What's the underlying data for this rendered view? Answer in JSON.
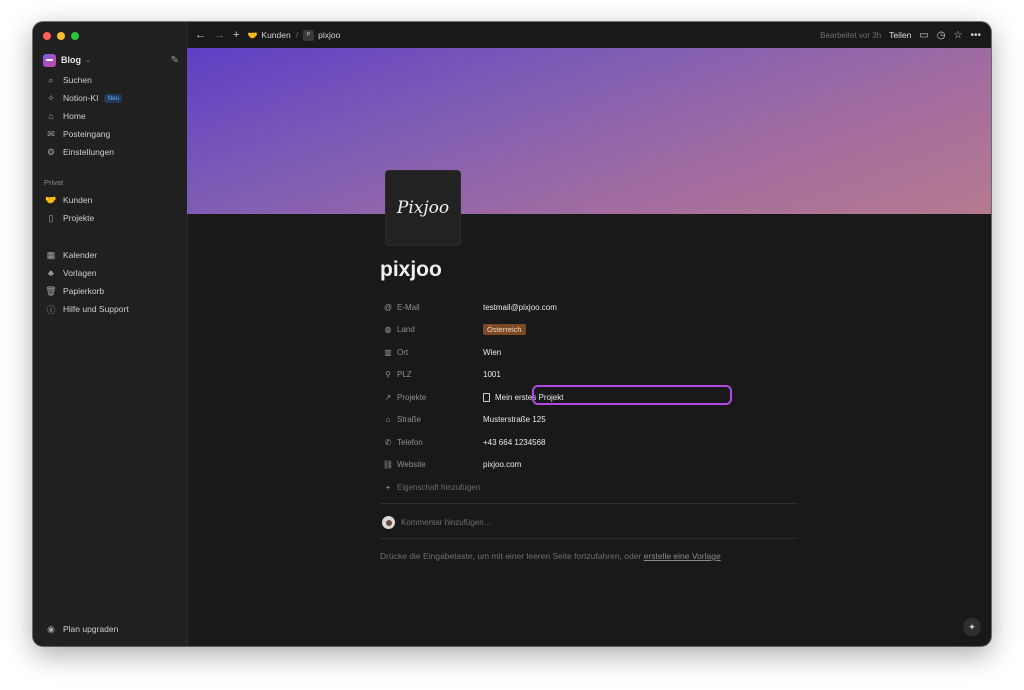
{
  "window": {
    "traffic_colors": [
      "#ff5f57",
      "#febc2e",
      "#28c840"
    ]
  },
  "sidebar": {
    "workspace_name": "Blog",
    "top_items": [
      {
        "label": "Suchen",
        "icon": "search-icon"
      },
      {
        "label": "Notion-KI",
        "icon": "sparkle-icon",
        "badge": "Neu"
      },
      {
        "label": "Home",
        "icon": "home-icon"
      },
      {
        "label": "Posteingang",
        "icon": "inbox-icon"
      },
      {
        "label": "Einstellungen",
        "icon": "gear-icon"
      }
    ],
    "section_label": "Privat",
    "private_items": [
      {
        "label": "Kunden",
        "icon": "handshake-icon"
      },
      {
        "label": "Projekte",
        "icon": "page-icon"
      }
    ],
    "tool_items": [
      {
        "label": "Kalender",
        "icon": "calendar-icon"
      },
      {
        "label": "Vorlagen",
        "icon": "templates-icon"
      },
      {
        "label": "Papierkorb",
        "icon": "trash-icon"
      },
      {
        "label": "Hilfe und Support",
        "icon": "help-icon"
      }
    ],
    "upgrade_label": "Plan upgraden"
  },
  "topbar": {
    "breadcrumb": [
      {
        "label": "Kunden",
        "icon": "handshake-icon"
      },
      {
        "label": "pixjoo",
        "icon": "page-thumb-icon"
      }
    ],
    "edited": "Bearbeitet vor 3h",
    "share": "Teilen"
  },
  "page": {
    "icon_text": "Pixjoo",
    "title": "pixjoo",
    "properties": [
      {
        "key": "E-Mail",
        "icon": "at-icon",
        "value": "testmail@pixjoo.com",
        "type": "text"
      },
      {
        "key": "Land",
        "icon": "globe-icon",
        "value": "Österreich",
        "type": "tag"
      },
      {
        "key": "Ort",
        "icon": "city-icon",
        "value": "Wien",
        "type": "text"
      },
      {
        "key": "PLZ",
        "icon": "pin-icon",
        "value": "1001",
        "type": "text"
      },
      {
        "key": "Projekte",
        "icon": "relation-arrow-icon",
        "value": "Mein erstes Projekt",
        "type": "relation"
      },
      {
        "key": "Straße",
        "icon": "house-icon",
        "value": "Musterstraße 125",
        "type": "text"
      },
      {
        "key": "Telefon",
        "icon": "phone-icon",
        "value": "+43 664 1234568",
        "type": "text"
      },
      {
        "key": "Website",
        "icon": "link-icon",
        "value": "pixjoo.com",
        "type": "text"
      }
    ],
    "add_property": "Eigenschaft hinzufügen",
    "comment_placeholder": "Kommentar hinzufügen...",
    "hint_text": "Drücke die Eingabetaste, um mit einer leeren Seite fortzufahren, oder ",
    "hint_link": "erstelle eine Vorlage"
  }
}
